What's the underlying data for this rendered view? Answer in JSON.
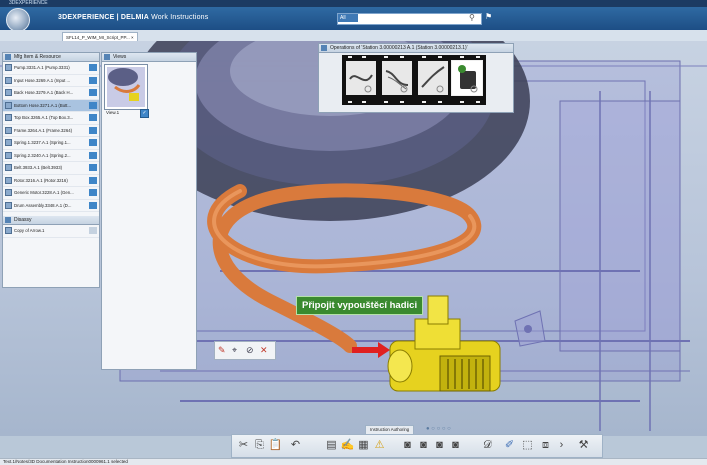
{
  "window": {
    "title": "3DEXPERIENCE"
  },
  "header": {
    "brand_prefix": "3DEXPERIENCE | DELMIA",
    "brand_suffix": "Work Instructions",
    "search_scope": "All"
  },
  "tab": {
    "label": "SFL14_P_WIM_MI_Script_PP..."
  },
  "tree_panel": {
    "title": "Mfg Item & Resource",
    "items": [
      {
        "label": "Pump.3331.A.1 (Pump.3331)"
      },
      {
        "label": "Input Hose.3269.A.1 (Input ..."
      },
      {
        "label": "Back Hose.3279.A.1 (Back H..."
      },
      {
        "label": "Bottom Hose.3271.A.1 (Bott...",
        "selected": true
      },
      {
        "label": "Top Box.3265.A.1 (Top Box.3..."
      },
      {
        "label": "Frame.3264.A.1 (Frame.3264)"
      },
      {
        "label": "Spring.1.3237.A.1 (Spring.1..."
      },
      {
        "label": "Spring.2.3240.A.1 (Spring.2..."
      },
      {
        "label": "Belt.3933.A.1 (Belt.3933)"
      },
      {
        "label": "Rotor.3216.A.1 (Rotor.3216)"
      },
      {
        "label": "Generic Motor.3228.A.1 (Gen..."
      },
      {
        "label": "Drum Assembly.3348.A.1 (D..."
      }
    ],
    "disassy": {
      "title": "Disassy",
      "items": [
        {
          "label": "Copy of Arrow.1"
        }
      ]
    }
  },
  "views_panel": {
    "title": "Views",
    "view_label": "View.1"
  },
  "ops_panel": {
    "title": "Operations of 'Station 3.00000213 A.1 (Station 3.00000213.1)'"
  },
  "instruction": {
    "text": "Připojit vypouštěcí hadici"
  },
  "bottom": {
    "authoring_label": "Instruction Authoring"
  },
  "status": {
    "text": "Text.1/Notes/3D Documentation Instruction0000961.1 selected"
  },
  "icons": [
    "compass-icon",
    "search-icon",
    "tag-icon",
    "scissors-icon",
    "copy-icon",
    "paste-icon",
    "undo-icon",
    "note-icon",
    "warning-icon",
    "camera-icon",
    "measure-icon",
    "pen-icon"
  ]
}
